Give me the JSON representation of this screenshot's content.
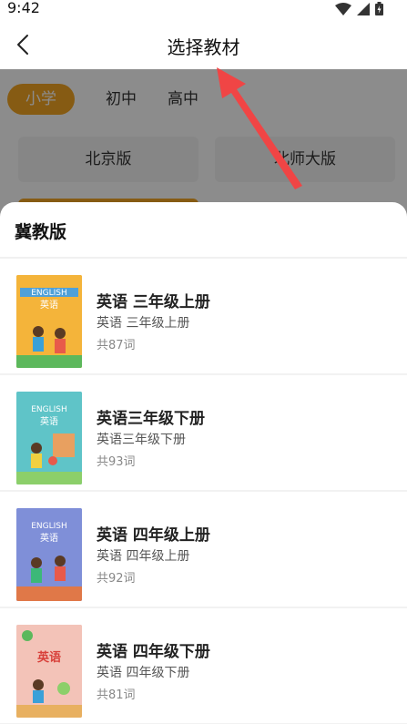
{
  "status_bar": {
    "time": "9:42"
  },
  "header": {
    "title": "选择教材"
  },
  "level_tabs": [
    {
      "label": "小学",
      "active": true
    },
    {
      "label": "初中",
      "active": false
    },
    {
      "label": "高中",
      "active": false
    }
  ],
  "publishers": [
    {
      "label": "北京版"
    },
    {
      "label": "北师大版"
    }
  ],
  "sheet": {
    "title": "冀教版",
    "books": [
      {
        "name": "英语 三年级上册",
        "subtitle": "英语 三年级上册",
        "count": "共87词",
        "cover_color": "#f4b43a"
      },
      {
        "name": "英语三年级下册",
        "subtitle": "英语三年级下册",
        "count": "共93词",
        "cover_color": "#5fc4c8"
      },
      {
        "name": "英语 四年级上册",
        "subtitle": "英语 四年级上册",
        "count": "共92词",
        "cover_color": "#7f8fd8"
      },
      {
        "name": "英语 四年级下册",
        "subtitle": "英语 四年级下册",
        "count": "共81词",
        "cover_color": "#f3c3b8"
      }
    ]
  },
  "colors": {
    "accent": "#f5a623",
    "arrow": "#f04545"
  }
}
